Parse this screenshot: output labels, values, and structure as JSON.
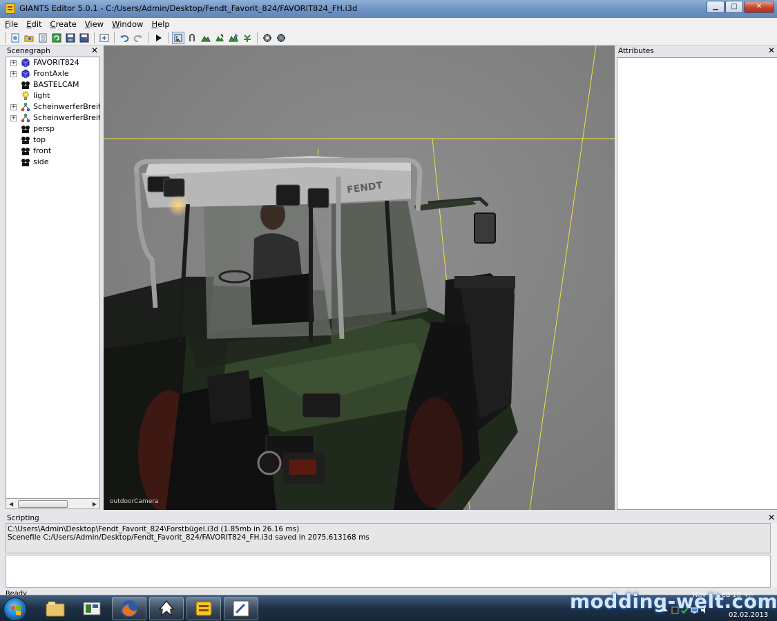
{
  "window": {
    "title": "GIANTS Editor 5.0.1 - C:/Users/Admin/Desktop/Fendt_Favorit_824/FAVORIT824_FH.i3d",
    "minimize_label": "▁",
    "maximize_label": "□",
    "close_label": "✕"
  },
  "menu": {
    "items": [
      {
        "key": "F",
        "rest": "ile"
      },
      {
        "key": "E",
        "rest": "dit"
      },
      {
        "key": "C",
        "rest": "reate"
      },
      {
        "key": "V",
        "rest": "iew"
      },
      {
        "key": "W",
        "rest": "indow"
      },
      {
        "key": "H",
        "rest": "elp"
      }
    ]
  },
  "toolbar": {
    "icons": [
      "new-icon",
      "open-icon",
      "properties-icon",
      "refresh-icon",
      "save-icon",
      "save-as-icon",
      "import-icon",
      "undo-icon",
      "redo-icon",
      "play-icon",
      "select-mode-icon",
      "move-mode-icon",
      "terrain-icon",
      "terrain-paint-icon",
      "foliage-icon",
      "vegetation-icon",
      "settings-icon",
      "settings-alt-icon"
    ]
  },
  "scenegraph": {
    "title": "Scenegraph",
    "close_label": "✕",
    "items": [
      {
        "label": "FAVORIT824",
        "icon": "transform-group-icon",
        "expandable": true
      },
      {
        "label": "FrontAxle",
        "icon": "transform-group-icon",
        "expandable": true
      },
      {
        "label": "BASTELCAM",
        "icon": "camera-icon",
        "expandable": false
      },
      {
        "label": "light",
        "icon": "light-bulb-icon",
        "expandable": false
      },
      {
        "label": "ScheinwerferBreit_Ha",
        "icon": "node-group-icon",
        "expandable": true
      },
      {
        "label": "ScheinwerferBreit_Ha",
        "icon": "node-group-icon",
        "expandable": true
      },
      {
        "label": "persp",
        "icon": "camera-icon",
        "expandable": false
      },
      {
        "label": "top",
        "icon": "camera-icon",
        "expandable": false
      },
      {
        "label": "front",
        "icon": "camera-icon",
        "expandable": false
      },
      {
        "label": "side",
        "icon": "camera-icon",
        "expandable": false
      }
    ]
  },
  "viewport": {
    "camera_label": "outdoorCamera",
    "cab_brand": "FENDT"
  },
  "attributes": {
    "title": "Attributes",
    "close_label": "✕"
  },
  "scripting": {
    "title": "Scripting",
    "close_label": "✕",
    "lines": [
      "C:\\Users\\Admin\\Desktop\\Fendt_Favorit_824\\Forstbügel.i3d (1.85mb in 26.16 ms)",
      "Scenefile C:/Users/Admin/Desktop/Fendt_Favorit_824/FAVORIT824_FH.i3d saved in 2075.613168 ms"
    ]
  },
  "status": {
    "text": "Ready",
    "nav_speed": "Nav Speed 10 +/-"
  },
  "taskbar": {
    "apps": [
      "explorer-icon",
      "media-icon",
      "firefox-icon",
      "inkscape-icon",
      "giants-editor-icon",
      "paint-icon"
    ],
    "date": "02.02.2013"
  },
  "watermark": "modding-welt.com"
}
